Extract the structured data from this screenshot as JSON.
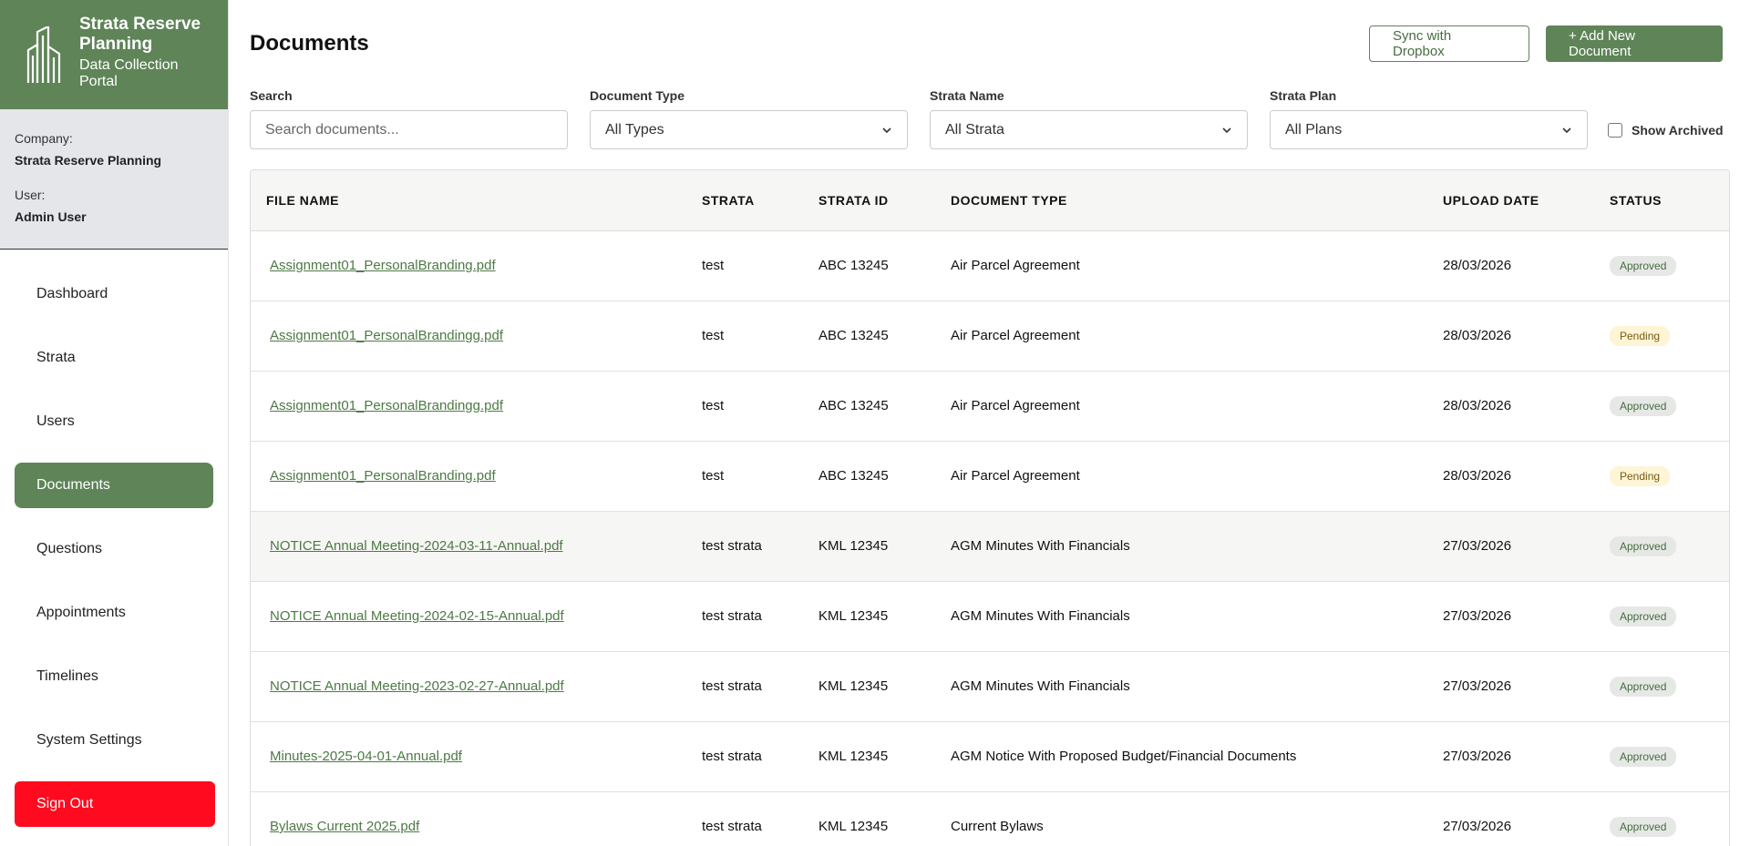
{
  "brand": {
    "title": "Strata Reserve Planning",
    "subtitle": "Data Collection Portal"
  },
  "account": {
    "company_label": "Company:",
    "company": "Strata Reserve Planning",
    "user_label": "User:",
    "user": "Admin User"
  },
  "nav": {
    "items": [
      {
        "label": "Dashboard"
      },
      {
        "label": "Strata"
      },
      {
        "label": "Users"
      },
      {
        "label": "Documents",
        "active": true
      },
      {
        "label": "Questions"
      },
      {
        "label": "Appointments"
      },
      {
        "label": "Timelines"
      },
      {
        "label": "System Settings"
      }
    ],
    "signout": "Sign Out"
  },
  "header": {
    "title": "Documents",
    "sync_label": "Sync with Dropbox",
    "add_label": "+ Add New Document"
  },
  "filters": {
    "search_label": "Search",
    "search_placeholder": "Search documents...",
    "type_label": "Document Type",
    "type_value": "All Types",
    "strata_label": "Strata Name",
    "strata_value": "All Strata",
    "plan_label": "Strata Plan",
    "plan_value": "All Plans",
    "archived_label": "Show Archived"
  },
  "table": {
    "columns": [
      "FILE NAME",
      "STRATA",
      "STRATA ID",
      "DOCUMENT TYPE",
      "UPLOAD DATE",
      "STATUS"
    ],
    "rows": [
      {
        "file": "Assignment01_PersonalBranding.pdf",
        "strata": "test",
        "id": "ABC 13245",
        "type": "Air Parcel Agreement",
        "date": "28/03/2026",
        "status": "Approved"
      },
      {
        "file": "Assignment01_PersonalBrandingg.pdf",
        "strata": "test",
        "id": "ABC 13245",
        "type": "Air Parcel Agreement",
        "date": "28/03/2026",
        "status": "Pending"
      },
      {
        "file": "Assignment01_PersonalBrandingg.pdf",
        "strata": "test",
        "id": "ABC 13245",
        "type": "Air Parcel Agreement",
        "date": "28/03/2026",
        "status": "Approved"
      },
      {
        "file": "Assignment01_PersonalBranding.pdf",
        "strata": "test",
        "id": "ABC 13245",
        "type": "Air Parcel Agreement",
        "date": "28/03/2026",
        "status": "Pending"
      },
      {
        "file": "NOTICE Annual Meeting-2024-03-11-Annual.pdf",
        "strata": "test strata",
        "id": "KML 12345",
        "type": "AGM Minutes With Financials",
        "date": "27/03/2026",
        "status": "Approved",
        "highlight": true
      },
      {
        "file": "NOTICE Annual Meeting-2024-02-15-Annual.pdf",
        "strata": "test strata",
        "id": "KML 12345",
        "type": "AGM Minutes With Financials",
        "date": "27/03/2026",
        "status": "Approved"
      },
      {
        "file": "NOTICE Annual Meeting-2023-02-27-Annual.pdf",
        "strata": "test strata",
        "id": "KML 12345",
        "type": "AGM Minutes With Financials",
        "date": "27/03/2026",
        "status": "Approved"
      },
      {
        "file": "Minutes-2025-04-01-Annual.pdf",
        "strata": "test strata",
        "id": "KML 12345",
        "type": "AGM Notice With Proposed Budget/Financial Documents",
        "date": "27/03/2026",
        "status": "Approved"
      },
      {
        "file": "Bylaws Current 2025.pdf",
        "strata": "test strata",
        "id": "KML 12345",
        "type": "Current Bylaws",
        "date": "27/03/2026",
        "status": "Approved"
      }
    ]
  },
  "colors": {
    "brand_green": "#5e8457",
    "signout_red": "#ff0a1e",
    "approved_bg": "#e6e8e6",
    "pending_bg": "#fdf5d6"
  }
}
